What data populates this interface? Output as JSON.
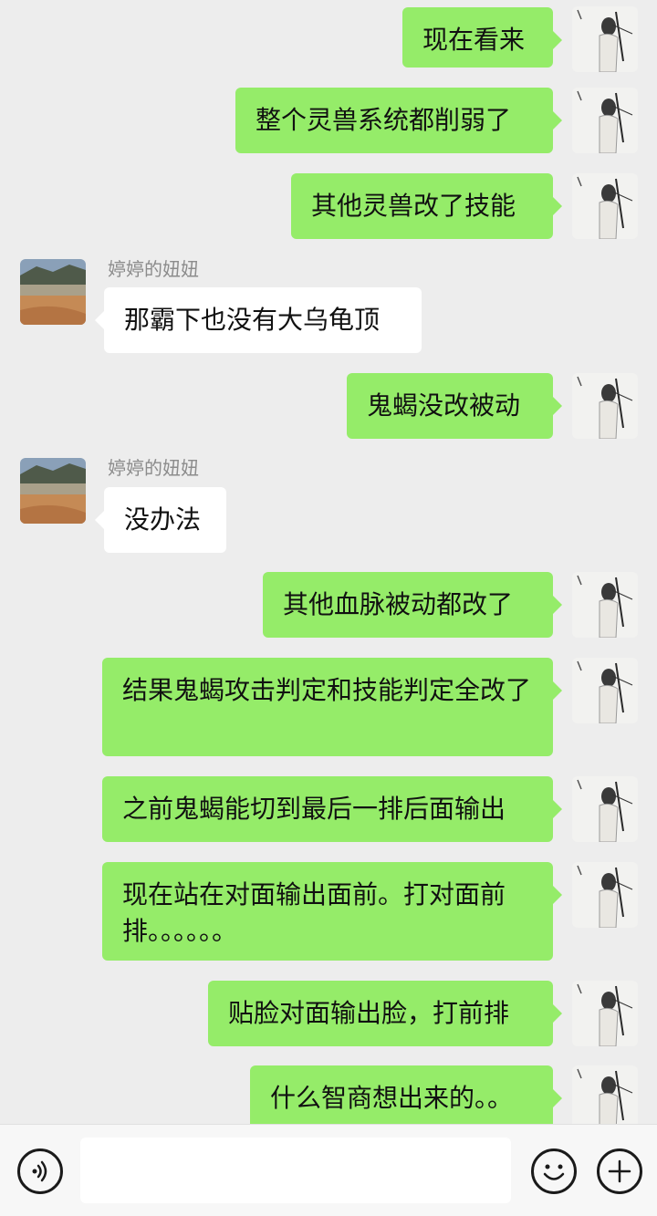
{
  "contact": {
    "name": "婷婷的妞妞"
  },
  "messages": [
    {
      "from": "me",
      "text": "现在看来"
    },
    {
      "from": "me",
      "text": "整个灵兽系统都削弱了"
    },
    {
      "from": "me",
      "text": "其他灵兽改了技能"
    },
    {
      "from": "other",
      "sender": "婷婷的妞妞",
      "text": "那霸下也没有大乌龟顶"
    },
    {
      "from": "me",
      "text": "鬼蝎没改被动"
    },
    {
      "from": "other",
      "sender": "婷婷的妞妞",
      "text": "没办法"
    },
    {
      "from": "me",
      "text": "其他血脉被动都改了"
    },
    {
      "from": "me",
      "text": "结果鬼蝎攻击判定和技能判定全改了"
    },
    {
      "from": "me",
      "text": "之前鬼蝎能切到最后一排后面输出"
    },
    {
      "from": "me",
      "text": "现在站在对面输出面前。打对面前排。。。。。。"
    },
    {
      "from": "me",
      "text": "贴脸对面输出脸，打前排"
    },
    {
      "from": "me",
      "text": "什么智商想出来的。。"
    }
  ],
  "input_bar": {
    "voice_icon": "voice-icon",
    "emoji_icon": "emoji-icon",
    "plus_icon": "plus-icon",
    "input_value": ""
  },
  "colors": {
    "background": "#ededed",
    "my_bubble": "#95ec69",
    "other_bubble": "#ffffff",
    "name_text": "#8c8c8c"
  }
}
